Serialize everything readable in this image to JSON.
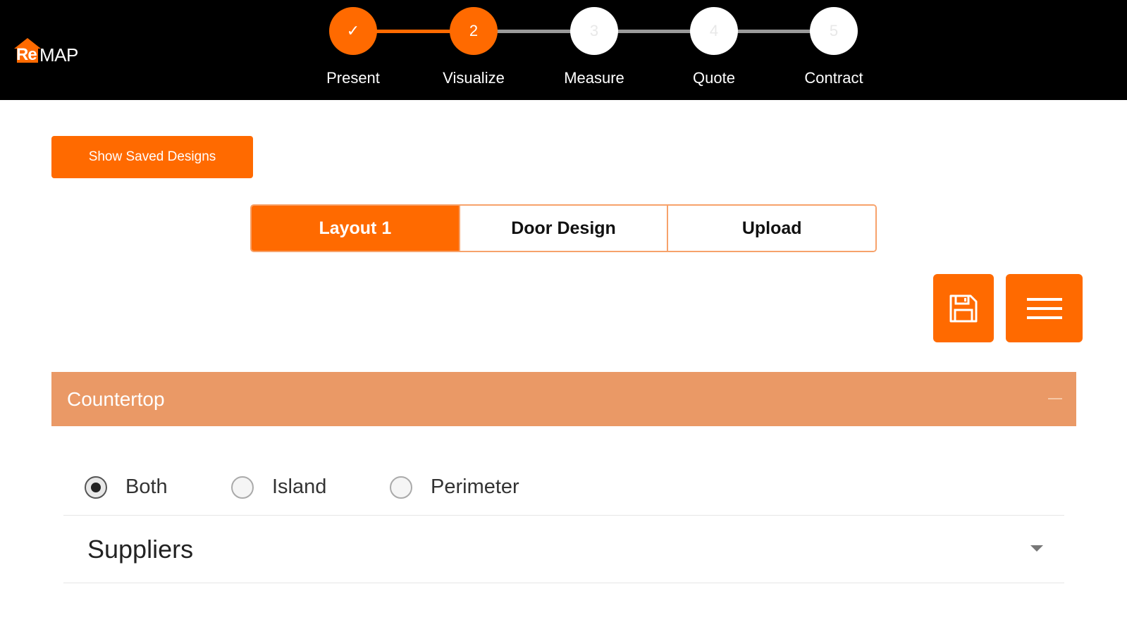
{
  "app": {
    "logo_re": "Re",
    "logo_map": "MAP",
    "brand_color": "#ff6a00"
  },
  "stepper": {
    "steps": [
      {
        "number": "✓",
        "label": "Present",
        "state": "done"
      },
      {
        "number": "2",
        "label": "Visualize",
        "state": "current"
      },
      {
        "number": "3",
        "label": "Measure",
        "state": "todo"
      },
      {
        "number": "4",
        "label": "Quote",
        "state": "todo"
      },
      {
        "number": "5",
        "label": "Contract",
        "state": "todo"
      }
    ]
  },
  "actions": {
    "show_saved_label": "Show Saved Designs",
    "save_icon": "save-icon",
    "menu_icon": "hamburger-menu-icon"
  },
  "tabs": [
    {
      "label": "Layout 1",
      "active": true
    },
    {
      "label": "Door Design",
      "active": false
    },
    {
      "label": "Upload",
      "active": false
    }
  ],
  "panel": {
    "title": "Countertop",
    "collapse_icon": "minus-icon",
    "radio_options": [
      {
        "label": "Both",
        "checked": true
      },
      {
        "label": "Island",
        "checked": false
      },
      {
        "label": "Perimeter",
        "checked": false
      }
    ],
    "suppliers_label": "Suppliers"
  }
}
